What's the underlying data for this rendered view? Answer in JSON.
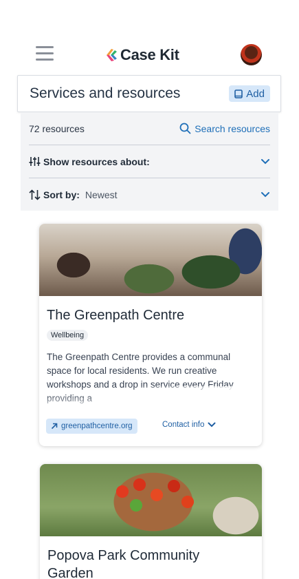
{
  "header": {
    "menu_icon": "hamburger-menu-icon",
    "logo_text": "Case Kit",
    "logo_colors": [
      "#f2a03d",
      "#e8437a",
      "#2fb36b",
      "#3b82c4"
    ],
    "avatar_icon": "user-avatar"
  },
  "page": {
    "title": "Services and resources",
    "add_label": "Add"
  },
  "filters": {
    "count": "72 resources",
    "search_label": "Search resources",
    "show_label": "Show resources about:",
    "sort_label": "Sort by:",
    "sort_value": "Newest"
  },
  "cards": [
    {
      "title": "The Greenpath Centre",
      "tag": "Wellbeing",
      "description": "The Greenpath Centre provides a communal space for local residents. We run creative workshops and a drop in service every Friday providing a",
      "website": "greenpathcentre.org",
      "contact_label": "Contact info"
    },
    {
      "title": "Popova Park Community Garden"
    }
  ],
  "colors": {
    "accent": "#1f6fb8",
    "accent_bg": "#d6e7f9",
    "filter_bg": "#f3f4f6"
  }
}
